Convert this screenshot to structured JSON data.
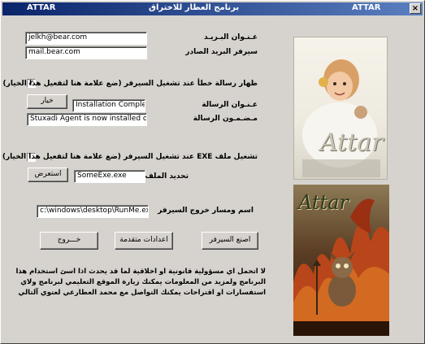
{
  "window": {
    "title_left": "ATTAR",
    "title_center": "برنامج العطار للاختراق",
    "title_right": "ATTAR",
    "close_glyph": "×"
  },
  "email": {
    "label": "عـنـوان البـريـد",
    "value": "jelkh@bear.com"
  },
  "smtp": {
    "label": "سيرفر البريد الصادر",
    "value": "mail.bear.com"
  },
  "error_msg": {
    "checkbox_checked": true,
    "checkbox_glyph": "✓",
    "checkbox_label": "ظهار رسالة خطأ عند تشغيل السيرفر (ضع علامة هنا لتفعيل هذا الخيار)",
    "choose_button": "خيار",
    "title_label": "عـنـوان الرسالة",
    "title_value": "Installation Complete",
    "body_label": "مـضـمـون الرسالة",
    "body_value": "Stuxadi Agent is now installed on yo"
  },
  "bind_exe": {
    "checkbox_checked": false,
    "checkbox_label": "تشغيل ملف EXE عند تشغيل السيرفر (ضع علامة هنا لتفعيل هذا الخيار)",
    "browse_button": "استعرض",
    "file_label": "تحديد الملف",
    "file_value": "SomeExe.exe"
  },
  "output": {
    "label": "اسم ومسار خروج السيرفر",
    "value": "c:\\windows\\desktop\\RunMe.exe"
  },
  "buttons": {
    "exit": "خـــروج",
    "advanced": "اعدادات متقدمة",
    "create": "اصنع السيرفر"
  },
  "disclaimer": {
    "line1": "لا اتحمل اي مسؤولية قانونية او اخلاقية لما قد يحدث اذا اسئ استخدام هذا",
    "line2": "البرنامج ولمزيد من المعلومات يمكنك زيارة الموقع التعليمي لبرنامج ولاي",
    "line3": "استفسارات او اقتراحات يمكنك التواصل مع محمد العطارعي لعتوي آلتالي"
  },
  "images": {
    "top_logo": "Attar",
    "bottom_logo": "Attar"
  },
  "colors": {
    "face": "#d6d3ce",
    "titlebar_start": "#0a246a",
    "titlebar_end": "#5a7fc0"
  }
}
